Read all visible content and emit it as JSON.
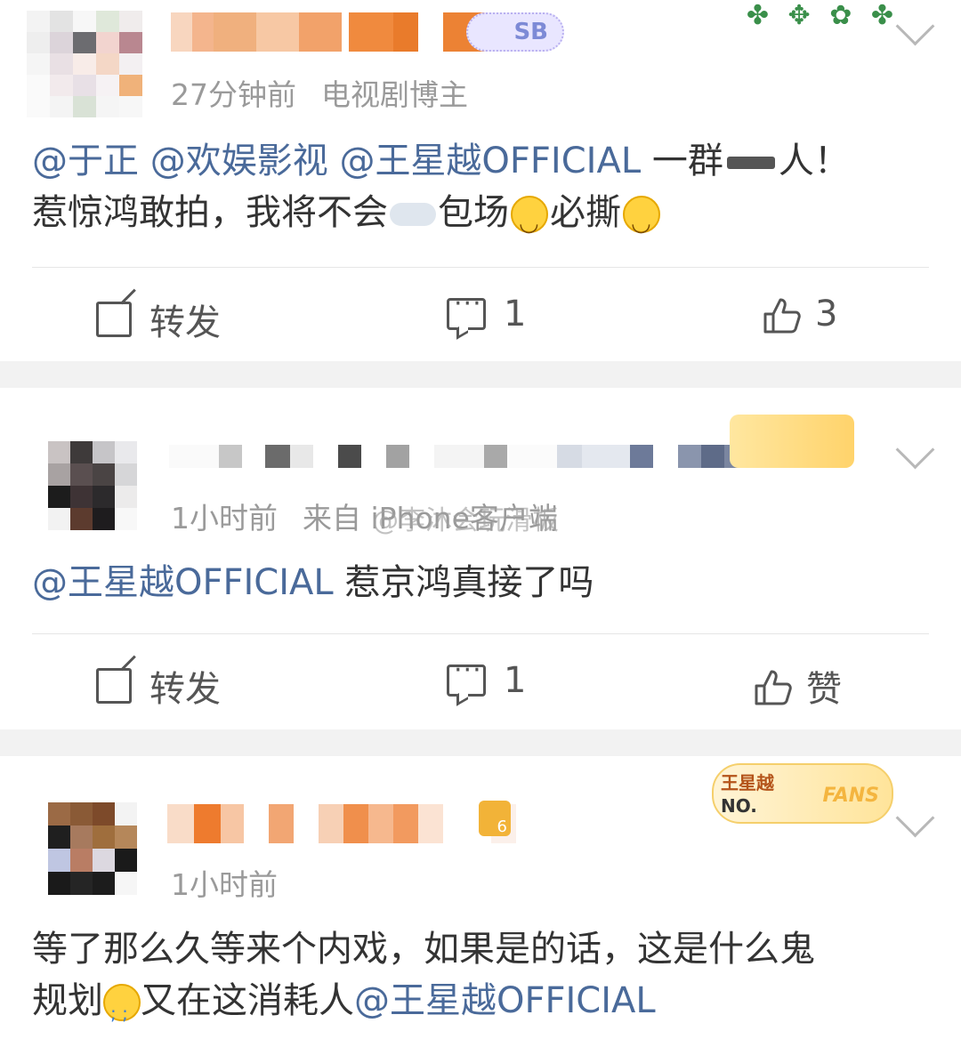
{
  "posts": [
    {
      "time": "27分钟前",
      "source": "电视剧博主",
      "badge": "SB",
      "content": {
        "mentions": [
          "@于正",
          "@欢娱影视",
          "@王星越OFFICIAL"
        ],
        "text1": "一群",
        "text2": "人！",
        "line2a": "惹惊鸿敢拍，我将不会",
        "line2b": "包场",
        "line2c": "必撕"
      },
      "actions": {
        "repost": "转发",
        "comments": "1",
        "likes": "3"
      }
    },
    {
      "time": "1小时前",
      "source": "来自 iPhone客户端",
      "watermark": "@李沐会玩滑板",
      "content": {
        "mention": "@王星越OFFICIAL",
        "text": "惹京鸿真接了吗"
      },
      "actions": {
        "repost": "转发",
        "comments": "1",
        "likes": "赞"
      }
    },
    {
      "time": "1小时前",
      "fans_badge": {
        "name": "王星越",
        "no": "NO.",
        "fans": "FANS"
      },
      "crown_level": "6",
      "content": {
        "line1": "等了那么久等来个内戏，如果是的话，这是什么鬼",
        "line2a": "规划",
        "line2b": "又在这消耗人",
        "mention": "@王星越OFFICIAL"
      }
    }
  ],
  "colors": {
    "mention": "#4a6a9a",
    "meta": "#9a9a9a",
    "separator": "#f2f2f2"
  }
}
